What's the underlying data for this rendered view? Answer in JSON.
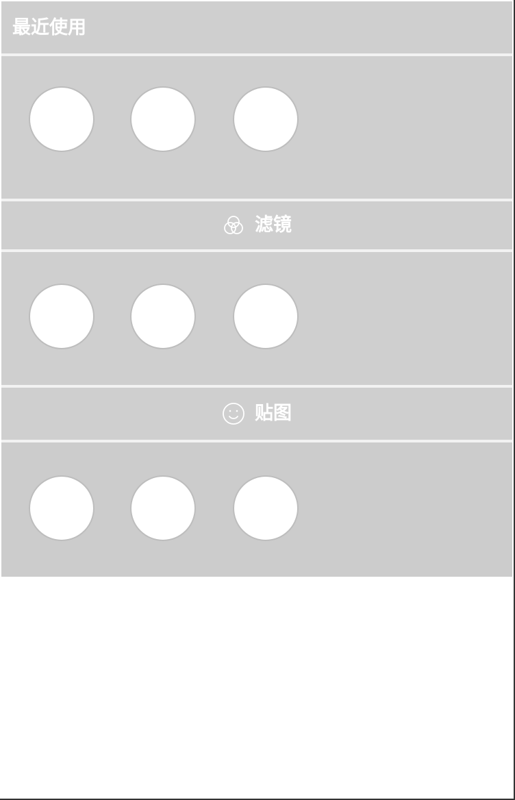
{
  "recent": {
    "title": "最近使用"
  },
  "filters": {
    "label": "滤镜",
    "icon": "filter-icon"
  },
  "stickers": {
    "label": "贴图",
    "icon": "smiley-icon"
  },
  "colors": {
    "panel": "#cfcfcf",
    "label": "#ffffff",
    "circle": "#ffffff",
    "circle_border": "#bdbdbd"
  }
}
